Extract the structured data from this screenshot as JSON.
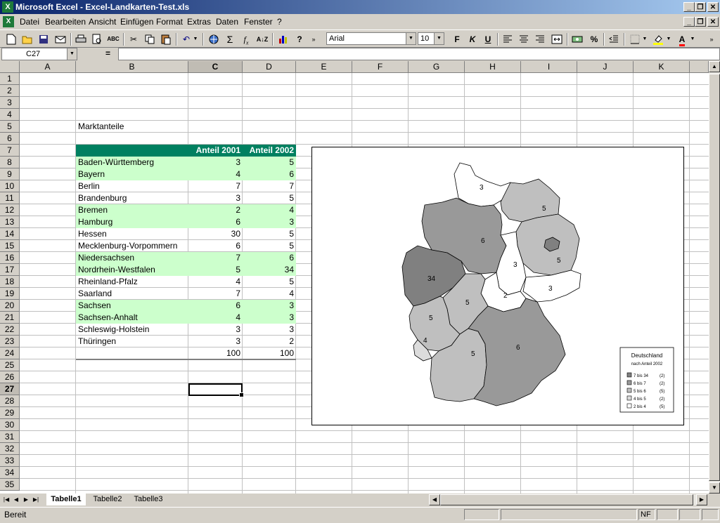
{
  "window": {
    "title": "Microsoft Excel - Excel-Landkarten-Test.xls",
    "app_icon": "excel-icon",
    "controls": [
      "minimize",
      "restore",
      "close"
    ]
  },
  "menu": {
    "items": [
      "Datei",
      "Bearbeiten",
      "Ansicht",
      "Einfügen",
      "Format",
      "Extras",
      "Daten",
      "Fenster",
      "?"
    ]
  },
  "toolbar": {
    "font": "Arial",
    "font_size": "10",
    "buttons_std": [
      "new",
      "open",
      "save",
      "mail",
      "print",
      "preview",
      "spell",
      "cut",
      "copy",
      "paste",
      "undo",
      "hyperlink",
      "autosum",
      "function",
      "sort-az",
      "chart-wizard",
      "help"
    ],
    "bold_glyph": "F",
    "italic_glyph": "K",
    "underline_glyph": "U",
    "percent_glyph": "%"
  },
  "formula_bar": {
    "cell_ref": "C27",
    "equals": "=",
    "value": ""
  },
  "sheet": {
    "columns": [
      "A",
      "B",
      "C",
      "D",
      "E",
      "F",
      "G",
      "H",
      "I",
      "J",
      "K"
    ],
    "selected_column": "C",
    "selected_row": "27",
    "rows": [
      "1",
      "2",
      "3",
      "4",
      "5",
      "6",
      "7",
      "8",
      "9",
      "10",
      "11",
      "12",
      "13",
      "14",
      "15",
      "16",
      "17",
      "18",
      "19",
      "20",
      "21",
      "22",
      "23",
      "24",
      "25",
      "26",
      "27",
      "28",
      "29",
      "30",
      "31",
      "32",
      "33",
      "34",
      "35"
    ],
    "title_cell": "Marktanteile",
    "header": {
      "col_c": "Anteil 2001",
      "col_d": "Anteil 2002"
    },
    "data": [
      {
        "land": "Baden-Württemberg",
        "a2001": "3",
        "a2002": "5",
        "hl": true
      },
      {
        "land": "Bayern",
        "a2001": "4",
        "a2002": "6",
        "hl": true
      },
      {
        "land": "Berlin",
        "a2001": "7",
        "a2002": "7",
        "hl": false
      },
      {
        "land": "Brandenburg",
        "a2001": "3",
        "a2002": "5",
        "hl": false
      },
      {
        "land": "Bremen",
        "a2001": "2",
        "a2002": "4",
        "hl": true
      },
      {
        "land": "Hamburg",
        "a2001": "6",
        "a2002": "3",
        "hl": true
      },
      {
        "land": "Hessen",
        "a2001": "30",
        "a2002": "5",
        "hl": false
      },
      {
        "land": "Mecklenburg-Vorpommern",
        "a2001": "6",
        "a2002": "5",
        "hl": false
      },
      {
        "land": "Niedersachsen",
        "a2001": "7",
        "a2002": "6",
        "hl": true
      },
      {
        "land": "Nordrhein-Westfalen",
        "a2001": "5",
        "a2002": "34",
        "hl": true
      },
      {
        "land": "Rheinland-Pfalz",
        "a2001": "4",
        "a2002": "5",
        "hl": false
      },
      {
        "land": "Saarland",
        "a2001": "7",
        "a2002": "4",
        "hl": false
      },
      {
        "land": "Sachsen",
        "a2001": "6",
        "a2002": "3",
        "hl": true
      },
      {
        "land": "Sachsen-Anhalt",
        "a2001": "4",
        "a2002": "3",
        "hl": true
      },
      {
        "land": "Schleswig-Holstein",
        "a2001": "3",
        "a2002": "3",
        "hl": false
      },
      {
        "land": "Thüringen",
        "a2001": "3",
        "a2002": "2",
        "hl": false
      }
    ],
    "totals": {
      "a2001": "100",
      "a2002": "100"
    }
  },
  "map": {
    "region_labels": {
      "sh": "3",
      "mv": "5",
      "ni": "6",
      "bb": "5",
      "st": "3",
      "nw": "34",
      "he": "5",
      "th": "2",
      "sn": "3",
      "rp": "5",
      "sl": "4",
      "bw": "5",
      "by": "6"
    },
    "legend": {
      "title": "Deutschland",
      "subtitle": "nach Anteil 2002",
      "items": [
        {
          "label": "7 bis 34",
          "count": "(2)",
          "color": "#808080"
        },
        {
          "label": "6 bis  7",
          "count": "(2)",
          "color": "#999999"
        },
        {
          "label": "5 bis  6",
          "count": "(5)",
          "color": "#bfbfbf"
        },
        {
          "label": "4 bis  5",
          "count": "(2)",
          "color": "#dcdcdc"
        },
        {
          "label": "2 bis  4",
          "count": "(5)",
          "color": "#ffffff"
        }
      ]
    }
  },
  "tabs": [
    "Tabelle1",
    "Tabelle2",
    "Tabelle3"
  ],
  "active_tab": "Tabelle1",
  "status": {
    "text": "Bereit",
    "nf": "NF"
  }
}
